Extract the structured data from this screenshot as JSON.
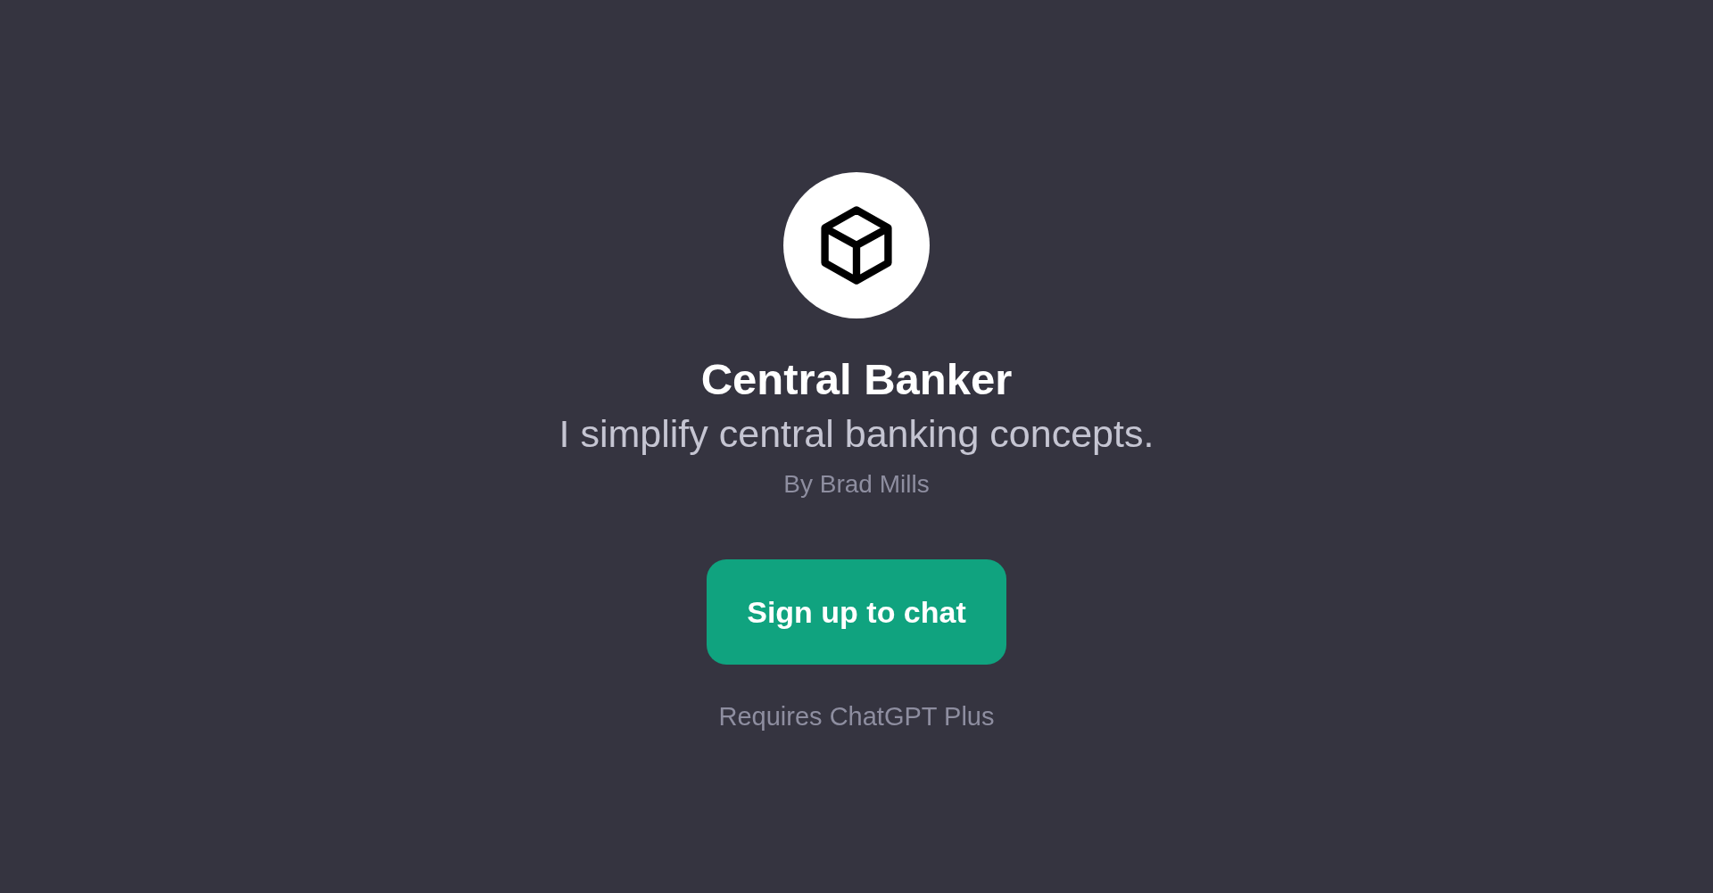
{
  "gpt": {
    "name": "Central Banker",
    "description": "I simplify central banking concepts.",
    "author": "By Brad Mills"
  },
  "signup_button": {
    "label": "Sign up to chat"
  },
  "note": "Requires ChatGPT Plus"
}
